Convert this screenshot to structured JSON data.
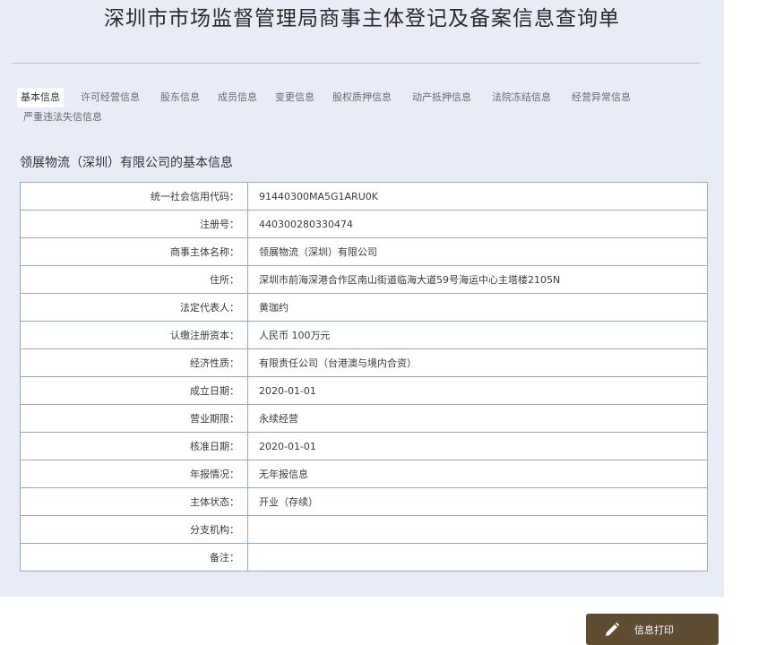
{
  "header": {
    "title": "深圳市市场监督管理局商事主体登记及备案信息查询单"
  },
  "tabs": [
    {
      "label": "基本信息",
      "active": true
    },
    {
      "label": "许可经营信息"
    },
    {
      "label": "股东信息"
    },
    {
      "label": "成员信息"
    },
    {
      "label": "变更信息"
    },
    {
      "label": "股权质押信息"
    },
    {
      "label": "动产抵押信息"
    },
    {
      "label": "法院冻结信息"
    },
    {
      "label": "经营异常信息"
    },
    {
      "label": "严重违法失信信息"
    }
  ],
  "section": {
    "title": "领展物流（深圳）有限公司的基本信息"
  },
  "info": [
    {
      "label": "统一社会信用代码：",
      "value": "91440300MA5G1ARU0K"
    },
    {
      "label": "注册号：",
      "value": "440300280330474"
    },
    {
      "label": "商事主体名称：",
      "value": "领展物流（深圳）有限公司"
    },
    {
      "label": "住所：",
      "value": "深圳市前海深港合作区南山街道临海大道59号海运中心主塔楼2105N"
    },
    {
      "label": "法定代表人：",
      "value": "黄珈约"
    },
    {
      "label": "认缴注册资本：",
      "value": "人民币 100万元"
    },
    {
      "label": "经济性质：",
      "value": "有限责任公司（台港澳与境内合资）"
    },
    {
      "label": "成立日期：",
      "value": "2020-01-01"
    },
    {
      "label": "营业期限：",
      "value": "永续经营"
    },
    {
      "label": "核准日期：",
      "value": "2020-01-01"
    },
    {
      "label": "年报情况：",
      "value": "无年报信息"
    },
    {
      "label": "主体状态：",
      "value": "开业（存续）"
    },
    {
      "label": "分支机构：",
      "value": ""
    },
    {
      "label": "备注：",
      "value": ""
    }
  ],
  "print_button": {
    "label": "信息打印",
    "icon": "pencil-icon"
  },
  "colors": {
    "panel_bg": "#e8ecf7",
    "button_bg": "#5e4c33",
    "border": "#9fa6b7"
  }
}
